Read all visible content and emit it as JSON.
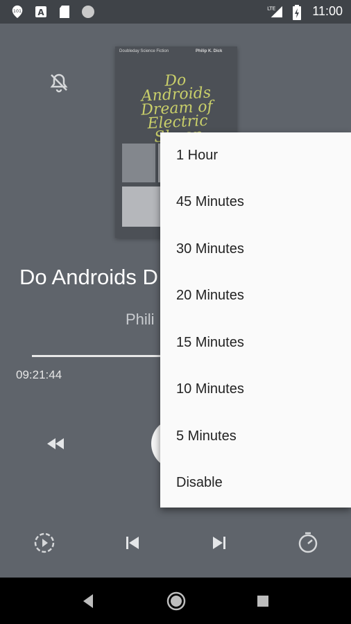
{
  "status_bar": {
    "time": "11:00",
    "network": "LTE",
    "icons": [
      "audiobook-app-icon",
      "a-notification-icon",
      "sd-card-icon",
      "record-icon",
      "signal-icon",
      "battery-charging-icon"
    ]
  },
  "player": {
    "cover": {
      "publisher": "Doubleday Science Fiction",
      "author": "Philip K. Dick",
      "title": "Do Androids Dream of Electric Sheep"
    },
    "title": "Do Androids D",
    "author": "Phili",
    "elapsed": "09:21:44",
    "progress_fraction": 0.45
  },
  "sleep_menu": {
    "options": [
      "1 Hour",
      "45 Minutes",
      "30 Minutes",
      "20 Minutes",
      "15 Minutes",
      "10 Minutes",
      "5 Minutes",
      "Disable"
    ]
  },
  "nav_bar": {
    "icons": [
      "back-icon",
      "home-icon",
      "recents-icon"
    ]
  },
  "colors": {
    "player_bg": "#5f646b",
    "status_bg": "#3f4348",
    "menu_bg": "#fafafa",
    "cover_title": "#c9cf6a"
  }
}
